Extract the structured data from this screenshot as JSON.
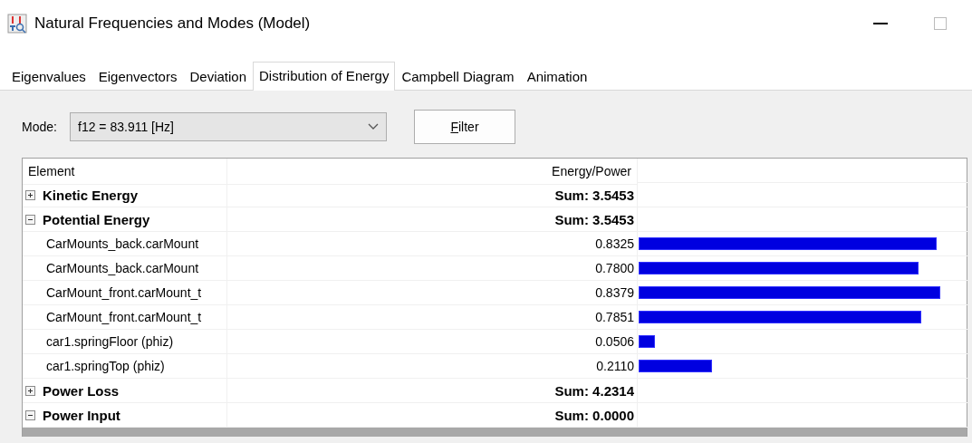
{
  "window": {
    "title": "Natural Frequencies and Modes (Model)"
  },
  "tabs": [
    {
      "label": "Eigenvalues",
      "selected": false
    },
    {
      "label": "Eigenvectors",
      "selected": false
    },
    {
      "label": "Deviation",
      "selected": false
    },
    {
      "label": "Distribution of Energy",
      "selected": true
    },
    {
      "label": "Campbell Diagram",
      "selected": false
    },
    {
      "label": "Animation",
      "selected": false
    }
  ],
  "mode": {
    "label": "Mode:",
    "value": "f12 = 83.911 [Hz]"
  },
  "filter_button": "Filter",
  "table": {
    "columns": [
      "Element",
      "Energy/Power"
    ],
    "rows": [
      {
        "kind": "group",
        "expanded": false,
        "name": "Kinetic Energy",
        "value": "Sum: 3.5453"
      },
      {
        "kind": "group",
        "expanded": true,
        "name": "Potential Energy",
        "value": "Sum: 3.5453"
      },
      {
        "kind": "item",
        "name": "CarMounts_back.carMount",
        "value": "0.8325",
        "level": 0.909
      },
      {
        "kind": "item",
        "name": "CarMounts_back.carMount",
        "value": "0.7800",
        "level": 0.854
      },
      {
        "kind": "item",
        "name": "CarMount_front.carMount_t",
        "value": "0.8379",
        "level": 0.92
      },
      {
        "kind": "item",
        "name": "CarMount_front.carMount_t",
        "value": "0.7851",
        "level": 0.862
      },
      {
        "kind": "item",
        "name": "car1.springFloor (phiz)",
        "value": "0.0506",
        "level": 0.05
      },
      {
        "kind": "item",
        "name": "car1.springTop (phiz)",
        "value": "0.2110",
        "level": 0.224
      },
      {
        "kind": "group",
        "expanded": false,
        "name": "Power Loss",
        "value": "Sum: 4.2314"
      },
      {
        "kind": "group",
        "expanded": true,
        "name": "Power Input",
        "value": "Sum: 0.0000"
      }
    ]
  }
}
